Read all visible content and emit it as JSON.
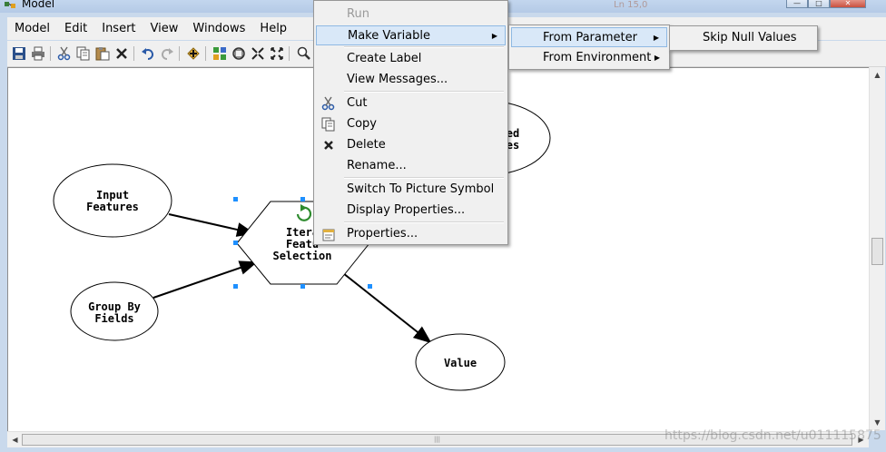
{
  "window": {
    "title": "Model",
    "faint_text": "Ln 15,0"
  },
  "menubar": {
    "items": [
      "Model",
      "Edit",
      "Insert",
      "View",
      "Windows",
      "Help"
    ]
  },
  "diagram": {
    "nodes": {
      "input_features": [
        "Input",
        "Features"
      ],
      "group_by_fields": [
        "Group By",
        "Fields"
      ],
      "iterate": [
        "Itera",
        "Featu",
        "Selection"
      ],
      "value": [
        "Value"
      ],
      "hidden_right": [
        "ed",
        "es"
      ]
    }
  },
  "context_menu": {
    "items": [
      {
        "label": "Run",
        "disabled": true
      },
      {
        "label": "Make Variable",
        "submenu": true,
        "highlighted": true
      },
      {
        "label": "Create Label"
      },
      {
        "label": "View Messages..."
      },
      {
        "label": "Cut",
        "icon": "scissors-icon"
      },
      {
        "label": "Copy",
        "icon": "copy-icon"
      },
      {
        "label": "Delete",
        "icon": "delete-x-icon"
      },
      {
        "label": "Rename..."
      },
      {
        "label": "Switch To Picture Symbol"
      },
      {
        "label": "Display Properties..."
      },
      {
        "label": "Properties...",
        "icon": "properties-icon"
      }
    ]
  },
  "submenu_make_variable": {
    "items": [
      {
        "label": "From Parameter",
        "submenu": true,
        "highlighted": true
      },
      {
        "label": "From Environment",
        "submenu": true
      }
    ]
  },
  "submenu_from_parameter": {
    "items": [
      {
        "label": "Skip Null Values"
      }
    ]
  },
  "watermark": "https://blog.csdn.net/u011115875",
  "colors": {
    "selection_handle": "#1e90ff",
    "iterator_icon": "#2e8b2e",
    "menu_highlight": "#d9e8f8"
  }
}
